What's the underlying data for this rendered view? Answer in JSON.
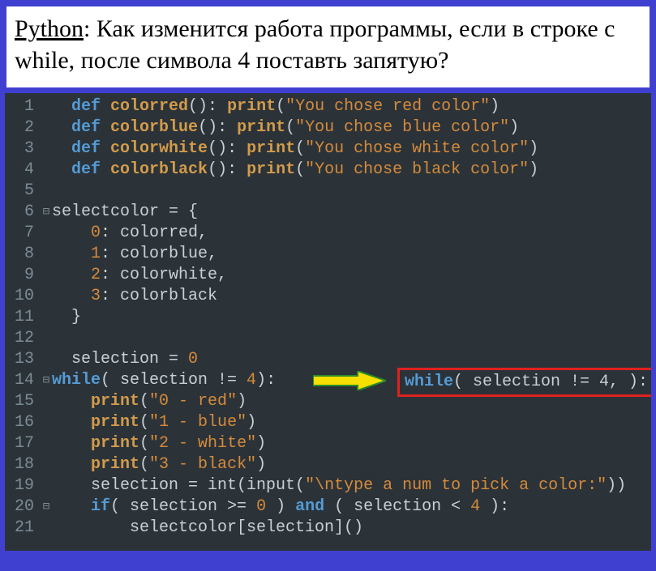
{
  "question": {
    "lang_label": "Python",
    "text_rest": ": Как изменится работа программы, если в строке с while, после символа  4 поставть запятую?"
  },
  "callout": {
    "kw": "while",
    "rest": "( selection != 4, ):"
  },
  "code": {
    "lines": [
      {
        "n": "1",
        "fold": "",
        "tokens": [
          [
            "pl",
            "  "
          ],
          [
            "kw",
            "def "
          ],
          [
            "fn",
            "colorred"
          ],
          [
            "pl",
            "(): "
          ],
          [
            "bi",
            "print"
          ],
          [
            "pl",
            "("
          ],
          [
            "str",
            "\"You chose red color\""
          ],
          [
            "pl",
            ")"
          ]
        ]
      },
      {
        "n": "2",
        "fold": "",
        "tokens": [
          [
            "pl",
            "  "
          ],
          [
            "kw",
            "def "
          ],
          [
            "fn",
            "colorblue"
          ],
          [
            "pl",
            "(): "
          ],
          [
            "bi",
            "print"
          ],
          [
            "pl",
            "("
          ],
          [
            "str",
            "\"You chose blue color\""
          ],
          [
            "pl",
            ")"
          ]
        ]
      },
      {
        "n": "3",
        "fold": "",
        "tokens": [
          [
            "pl",
            "  "
          ],
          [
            "kw",
            "def "
          ],
          [
            "fn",
            "colorwhite"
          ],
          [
            "pl",
            "(): "
          ],
          [
            "bi",
            "print"
          ],
          [
            "pl",
            "("
          ],
          [
            "str",
            "\"You chose white color\""
          ],
          [
            "pl",
            ")"
          ]
        ]
      },
      {
        "n": "4",
        "fold": "",
        "tokens": [
          [
            "pl",
            "  "
          ],
          [
            "kw",
            "def "
          ],
          [
            "fn",
            "colorblack"
          ],
          [
            "pl",
            "(): "
          ],
          [
            "bi",
            "print"
          ],
          [
            "pl",
            "("
          ],
          [
            "str",
            "\"You chose black color\""
          ],
          [
            "pl",
            ")"
          ]
        ]
      },
      {
        "n": "5",
        "fold": "",
        "tokens": []
      },
      {
        "n": "6",
        "fold": "⊟",
        "tokens": [
          [
            "pl",
            "selectcolor = {"
          ]
        ]
      },
      {
        "n": "7",
        "fold": "",
        "tokens": [
          [
            "pl",
            "    "
          ],
          [
            "num",
            "0"
          ],
          [
            "pl",
            ": colorred,"
          ]
        ]
      },
      {
        "n": "8",
        "fold": "",
        "tokens": [
          [
            "pl",
            "    "
          ],
          [
            "num",
            "1"
          ],
          [
            "pl",
            ": colorblue,"
          ]
        ]
      },
      {
        "n": "9",
        "fold": "",
        "tokens": [
          [
            "pl",
            "    "
          ],
          [
            "num",
            "2"
          ],
          [
            "pl",
            ": colorwhite,"
          ]
        ]
      },
      {
        "n": "10",
        "fold": "",
        "tokens": [
          [
            "pl",
            "    "
          ],
          [
            "num",
            "3"
          ],
          [
            "pl",
            ": colorblack"
          ]
        ]
      },
      {
        "n": "11",
        "fold": "",
        "tokens": [
          [
            "pl",
            "  }"
          ]
        ]
      },
      {
        "n": "12",
        "fold": "",
        "tokens": []
      },
      {
        "n": "13",
        "fold": "",
        "tokens": [
          [
            "pl",
            "  selection = "
          ],
          [
            "num",
            "0"
          ]
        ]
      },
      {
        "n": "14",
        "fold": "⊟",
        "tokens": [
          [
            "kw",
            "while"
          ],
          [
            "pl",
            "( selection != "
          ],
          [
            "num",
            "4"
          ],
          [
            "pl",
            "):"
          ]
        ]
      },
      {
        "n": "15",
        "fold": "",
        "tokens": [
          [
            "pl",
            "    "
          ],
          [
            "bi",
            "print"
          ],
          [
            "pl",
            "("
          ],
          [
            "str",
            "\"0 - red\""
          ],
          [
            "pl",
            ")"
          ]
        ]
      },
      {
        "n": "16",
        "fold": "",
        "tokens": [
          [
            "pl",
            "    "
          ],
          [
            "bi",
            "print"
          ],
          [
            "pl",
            "("
          ],
          [
            "str",
            "\"1 - blue\""
          ],
          [
            "pl",
            ")"
          ]
        ]
      },
      {
        "n": "17",
        "fold": "",
        "tokens": [
          [
            "pl",
            "    "
          ],
          [
            "bi",
            "print"
          ],
          [
            "pl",
            "("
          ],
          [
            "str",
            "\"2 - white\""
          ],
          [
            "pl",
            ")"
          ]
        ]
      },
      {
        "n": "18",
        "fold": "",
        "tokens": [
          [
            "pl",
            "    "
          ],
          [
            "bi",
            "print"
          ],
          [
            "pl",
            "("
          ],
          [
            "str",
            "\"3 - black\""
          ],
          [
            "pl",
            ")"
          ]
        ]
      },
      {
        "n": "19",
        "fold": "",
        "tokens": [
          [
            "pl",
            "    selection = int(input("
          ],
          [
            "str",
            "\"\\ntype a num to pick a color:\""
          ],
          [
            "pl",
            "))"
          ]
        ]
      },
      {
        "n": "20",
        "fold": "⊟",
        "tokens": [
          [
            "pl",
            "    "
          ],
          [
            "kw",
            "if"
          ],
          [
            "pl",
            "( selection >= "
          ],
          [
            "num",
            "0"
          ],
          [
            "pl",
            " ) "
          ],
          [
            "kw",
            "and"
          ],
          [
            "pl",
            " ( selection < "
          ],
          [
            "num",
            "4"
          ],
          [
            "pl",
            " ):"
          ]
        ]
      },
      {
        "n": "21",
        "fold": "",
        "tokens": [
          [
            "pl",
            "        selectcolor[selection]()"
          ]
        ]
      }
    ]
  }
}
